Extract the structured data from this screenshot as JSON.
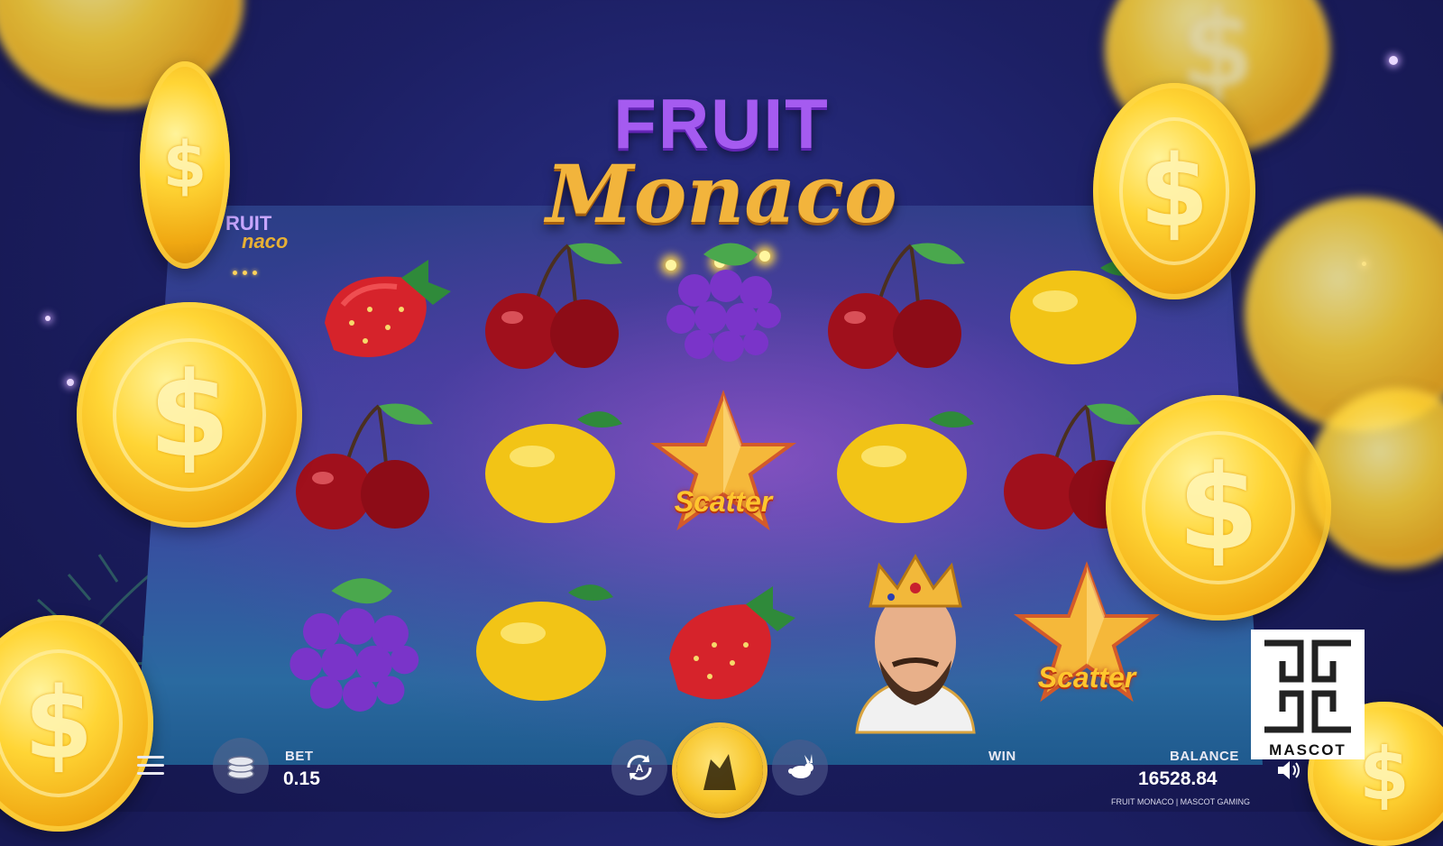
{
  "game": {
    "title_line1": "FRUIT",
    "title_line2": "Monaco",
    "mini_logo_line1": "RUIT",
    "mini_logo_line2": "naco"
  },
  "reels": {
    "symbols": [
      [
        "strawberry",
        "cherry",
        "grapes",
        "cherry",
        "lemon"
      ],
      [
        "cherry",
        "lemon",
        "scatter",
        "lemon",
        "cherry"
      ],
      [
        "grapes",
        "lemon",
        "strawberry",
        "king",
        "scatter"
      ]
    ],
    "scatter_label": "Scatter"
  },
  "controls": {
    "menu_icon": "hamburger-icon",
    "bet_icon": "coin-stack-icon",
    "autoplay_icon": "autoplay-icon",
    "spin_icon": "spin-icon",
    "turbo_icon": "rabbit-icon",
    "sound_icon": "speaker-icon"
  },
  "bottom_bar": {
    "bet_label": "BET",
    "bet_value": "0.15",
    "win_label": "WIN",
    "balance_label": "BALANCE",
    "balance_value": "16528.84",
    "footer_text": "FRUIT MONACO | MASCOT GAMING"
  },
  "brand": {
    "name": "MASCOT"
  },
  "colors": {
    "gold": "#f2b43c",
    "purple": "#a55bf0",
    "background": "#1c1f63"
  }
}
